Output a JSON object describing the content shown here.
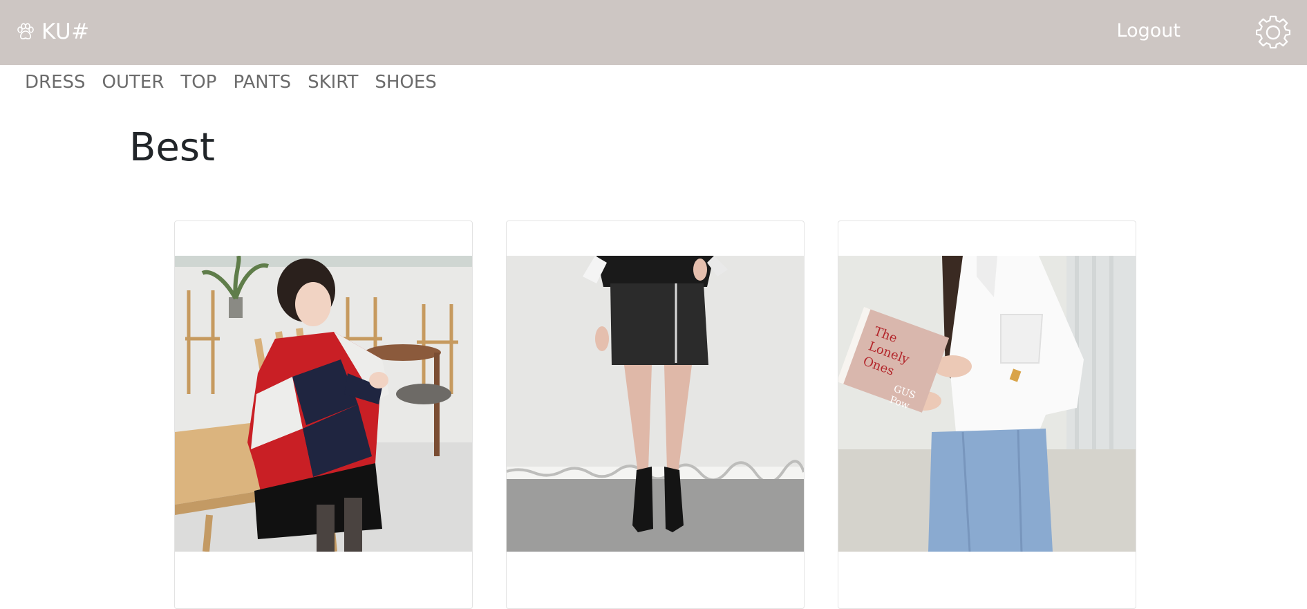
{
  "header": {
    "brand": "KU#",
    "brand_icon": "paw-icon",
    "logout_label": "Logout",
    "settings_icon": "gear-icon",
    "background": "#cdc6c3"
  },
  "categories": [
    "DRESS",
    "OUTER",
    "TOP",
    "PANTS",
    "SKIRT",
    "SHOES"
  ],
  "section": {
    "title": "Best"
  },
  "products": [
    {
      "image": "striped-cardigan-photo"
    },
    {
      "image": "black-mini-skirt-photo"
    },
    {
      "image": "white-shirt-photo",
      "book_text": [
        "The",
        "Lonely",
        "Ones"
      ],
      "book_subtext": [
        "GUS",
        "Pow"
      ]
    }
  ]
}
